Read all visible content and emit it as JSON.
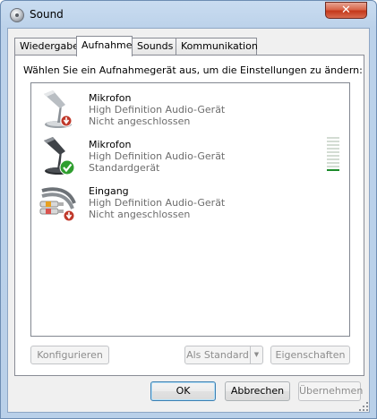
{
  "window": {
    "title": "Sound",
    "close_label": "✕"
  },
  "tabs": [
    {
      "label": "Wiedergabe",
      "active": false
    },
    {
      "label": "Aufnahme",
      "active": true
    },
    {
      "label": "Sounds",
      "active": false
    },
    {
      "label": "Kommunikation",
      "active": false
    }
  ],
  "instruction": "Wählen Sie ein Aufnahmegerät aus, um die Einstellungen zu ändern:",
  "devices": [
    {
      "name": "Mikrofon",
      "description": "High Definition Audio-Gerät",
      "status": "Nicht angeschlossen",
      "icon": "microphone-icon",
      "badge": "disconnected-badge-icon"
    },
    {
      "name": "Mikrofon",
      "description": "High Definition Audio-Gerät",
      "status": "Standardgerät",
      "icon": "microphone-icon",
      "badge": "default-checkmark-badge-icon",
      "level": 0.1
    },
    {
      "name": "Eingang",
      "description": "High Definition Audio-Gerät",
      "status": "Nicht angeschlossen",
      "icon": "rca-line-in-icon",
      "badge": "disconnected-badge-icon"
    }
  ],
  "buttons": {
    "configure": "Konfigurieren",
    "set_default": "Als Standard",
    "properties": "Eigenschaften",
    "ok": "OK",
    "cancel": "Abbrechen",
    "apply": "Übernehmen"
  },
  "colors": {
    "level_on": "#1c8b2b",
    "level_off": "#d3dcd3",
    "close": "#c4381b"
  }
}
